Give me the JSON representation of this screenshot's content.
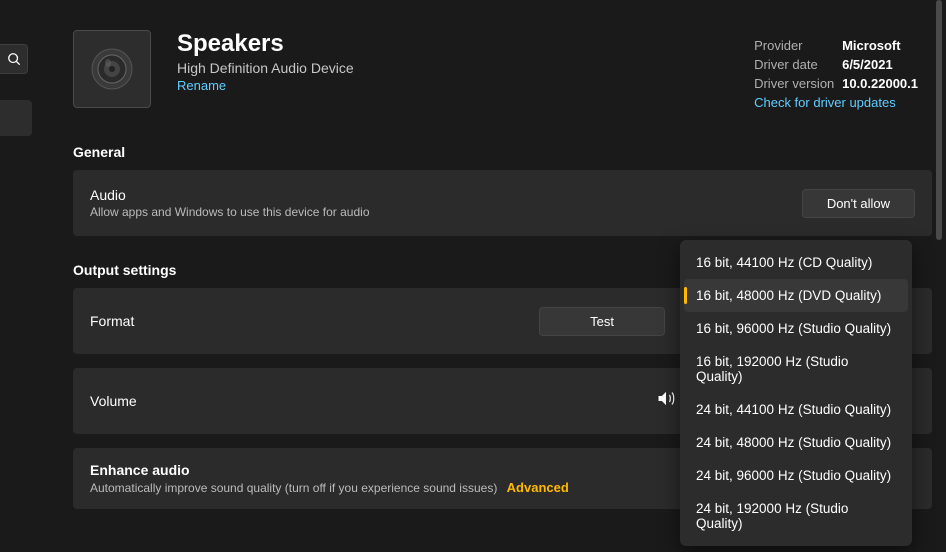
{
  "left_rail": {
    "search_icon": "search"
  },
  "header": {
    "title": "Speakers",
    "subtitle": "High Definition Audio Device",
    "rename": "Rename"
  },
  "driver": {
    "provider_label": "Provider",
    "provider_value": "Microsoft",
    "date_label": "Driver date",
    "date_value": "6/5/2021",
    "version_label": "Driver version",
    "version_value": "10.0.22000.1",
    "check_updates": "Check for driver updates"
  },
  "sections": {
    "general": "General",
    "output": "Output settings"
  },
  "audio_card": {
    "title": "Audio",
    "desc": "Allow apps and Windows to use this device for audio",
    "button": "Don't allow"
  },
  "format_card": {
    "title": "Format",
    "test_button": "Test"
  },
  "volume_card": {
    "title": "Volume"
  },
  "enhance_card": {
    "title": "Enhance audio",
    "desc": "Automatically improve sound quality (turn off if you experience sound issues)",
    "advanced": "Advanced"
  },
  "format_options": [
    "16 bit, 44100 Hz (CD Quality)",
    "16 bit, 48000 Hz (DVD Quality)",
    "16 bit, 96000 Hz (Studio Quality)",
    "16 bit, 192000 Hz (Studio Quality)",
    "24 bit, 44100 Hz (Studio Quality)",
    "24 bit, 48000 Hz (Studio Quality)",
    "24 bit, 96000 Hz (Studio Quality)",
    "24 bit, 192000 Hz (Studio Quality)"
  ],
  "selected_format_index": 1
}
